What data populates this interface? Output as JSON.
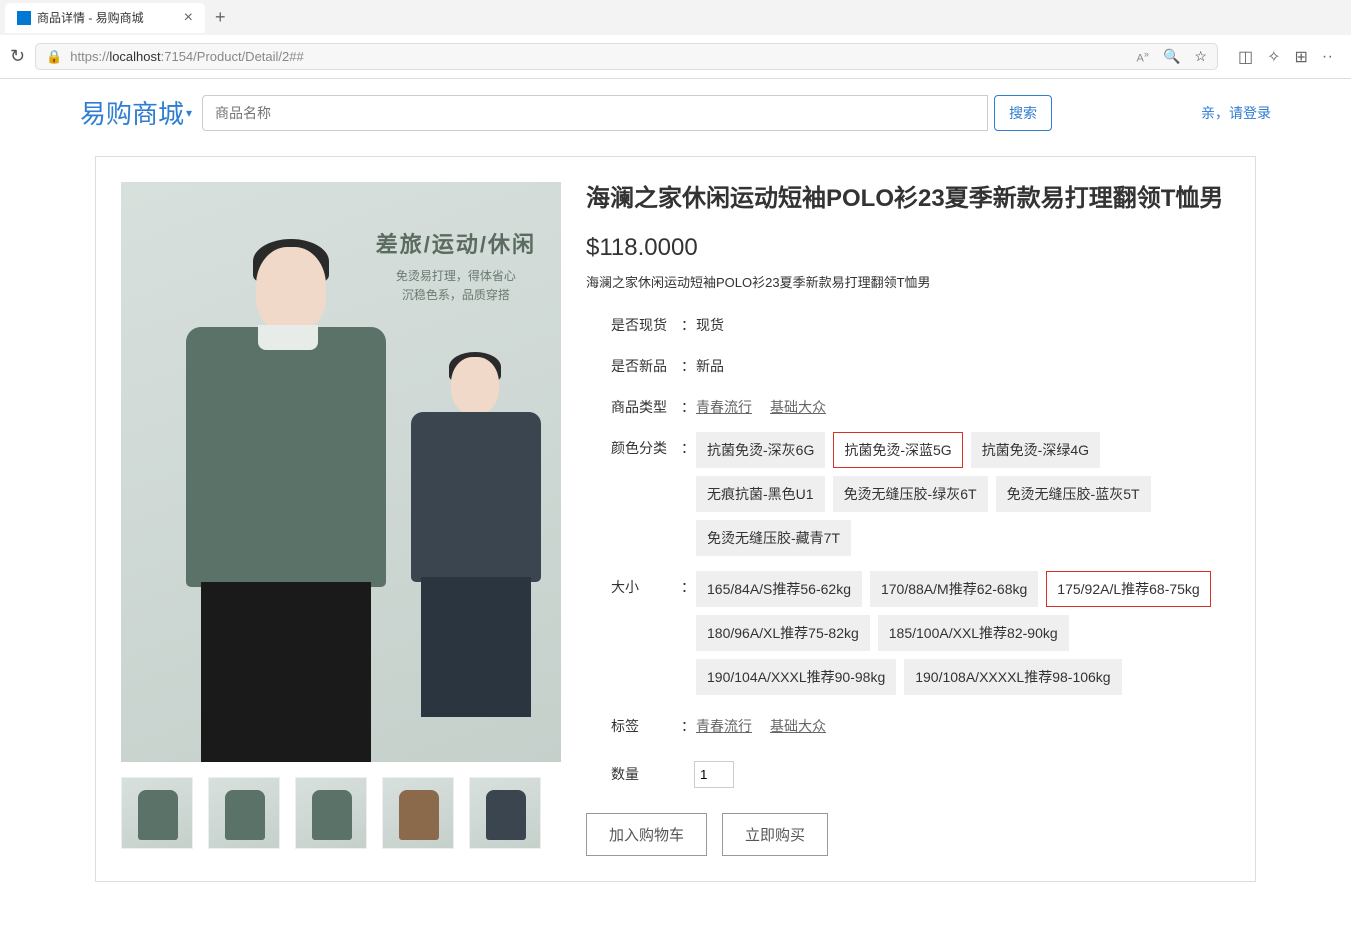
{
  "browser": {
    "tab_title": "商品详情 - 易购商城",
    "url_prefix": "https://",
    "url_host": "localhost",
    "url_rest": ":7154/Product/Detail/2##"
  },
  "header": {
    "logo": "易购商城",
    "search_placeholder": "商品名称",
    "search_btn": "搜索",
    "login_link": "亲，请登录"
  },
  "product": {
    "title": "海澜之家休闲运动短袖POLO衫23夏季新款易打理翻领T恤男",
    "price": "$118.0000",
    "description": "海澜之家休闲运动短袖POLO衫23夏季新款易打理翻领T恤男",
    "gallery_overlay": {
      "title": "差旅/运动/休闲",
      "line1": "免烫易打理，得体省心",
      "line2": "沉稳色系，品质穿搭"
    },
    "thumb_colors": [
      "#5a7268",
      "#5a7268",
      "#5a7268",
      "#8a6a4a",
      "#3a4550"
    ],
    "labels": {
      "stock": "是否现货",
      "new": "是否新品",
      "type": "商品类型",
      "color": "颜色分类",
      "size": "大小",
      "tags": "标签",
      "qty": "数量"
    },
    "colon": "：",
    "stock_value": "现货",
    "new_value": "新品",
    "type_links": [
      "青春流行",
      "基础大众"
    ],
    "colors": [
      {
        "label": "抗菌免烫-深灰6G",
        "selected": false
      },
      {
        "label": "抗菌免烫-深蓝5G",
        "selected": true
      },
      {
        "label": "抗菌免烫-深绿4G",
        "selected": false
      },
      {
        "label": "无痕抗菌-黑色U1",
        "selected": false
      },
      {
        "label": "免烫无缝压胶-绿灰6T",
        "selected": false
      },
      {
        "label": "免烫无缝压胶-蓝灰5T",
        "selected": false
      },
      {
        "label": "免烫无缝压胶-藏青7T",
        "selected": false
      }
    ],
    "sizes": [
      {
        "label": "165/84A/S推荐56-62kg",
        "selected": false
      },
      {
        "label": "170/88A/M推荐62-68kg",
        "selected": false
      },
      {
        "label": "175/92A/L推荐68-75kg",
        "selected": true
      },
      {
        "label": "180/96A/XL推荐75-82kg",
        "selected": false
      },
      {
        "label": "185/100A/XXL推荐82-90kg",
        "selected": false
      },
      {
        "label": "190/104A/XXXL推荐90-98kg",
        "selected": false
      },
      {
        "label": "190/108A/XXXXL推荐98-106kg",
        "selected": false
      }
    ],
    "tag_links": [
      "青春流行",
      "基础大众"
    ],
    "qty_value": "1",
    "actions": {
      "add_cart": "加入购物车",
      "buy_now": "立即购买"
    }
  }
}
